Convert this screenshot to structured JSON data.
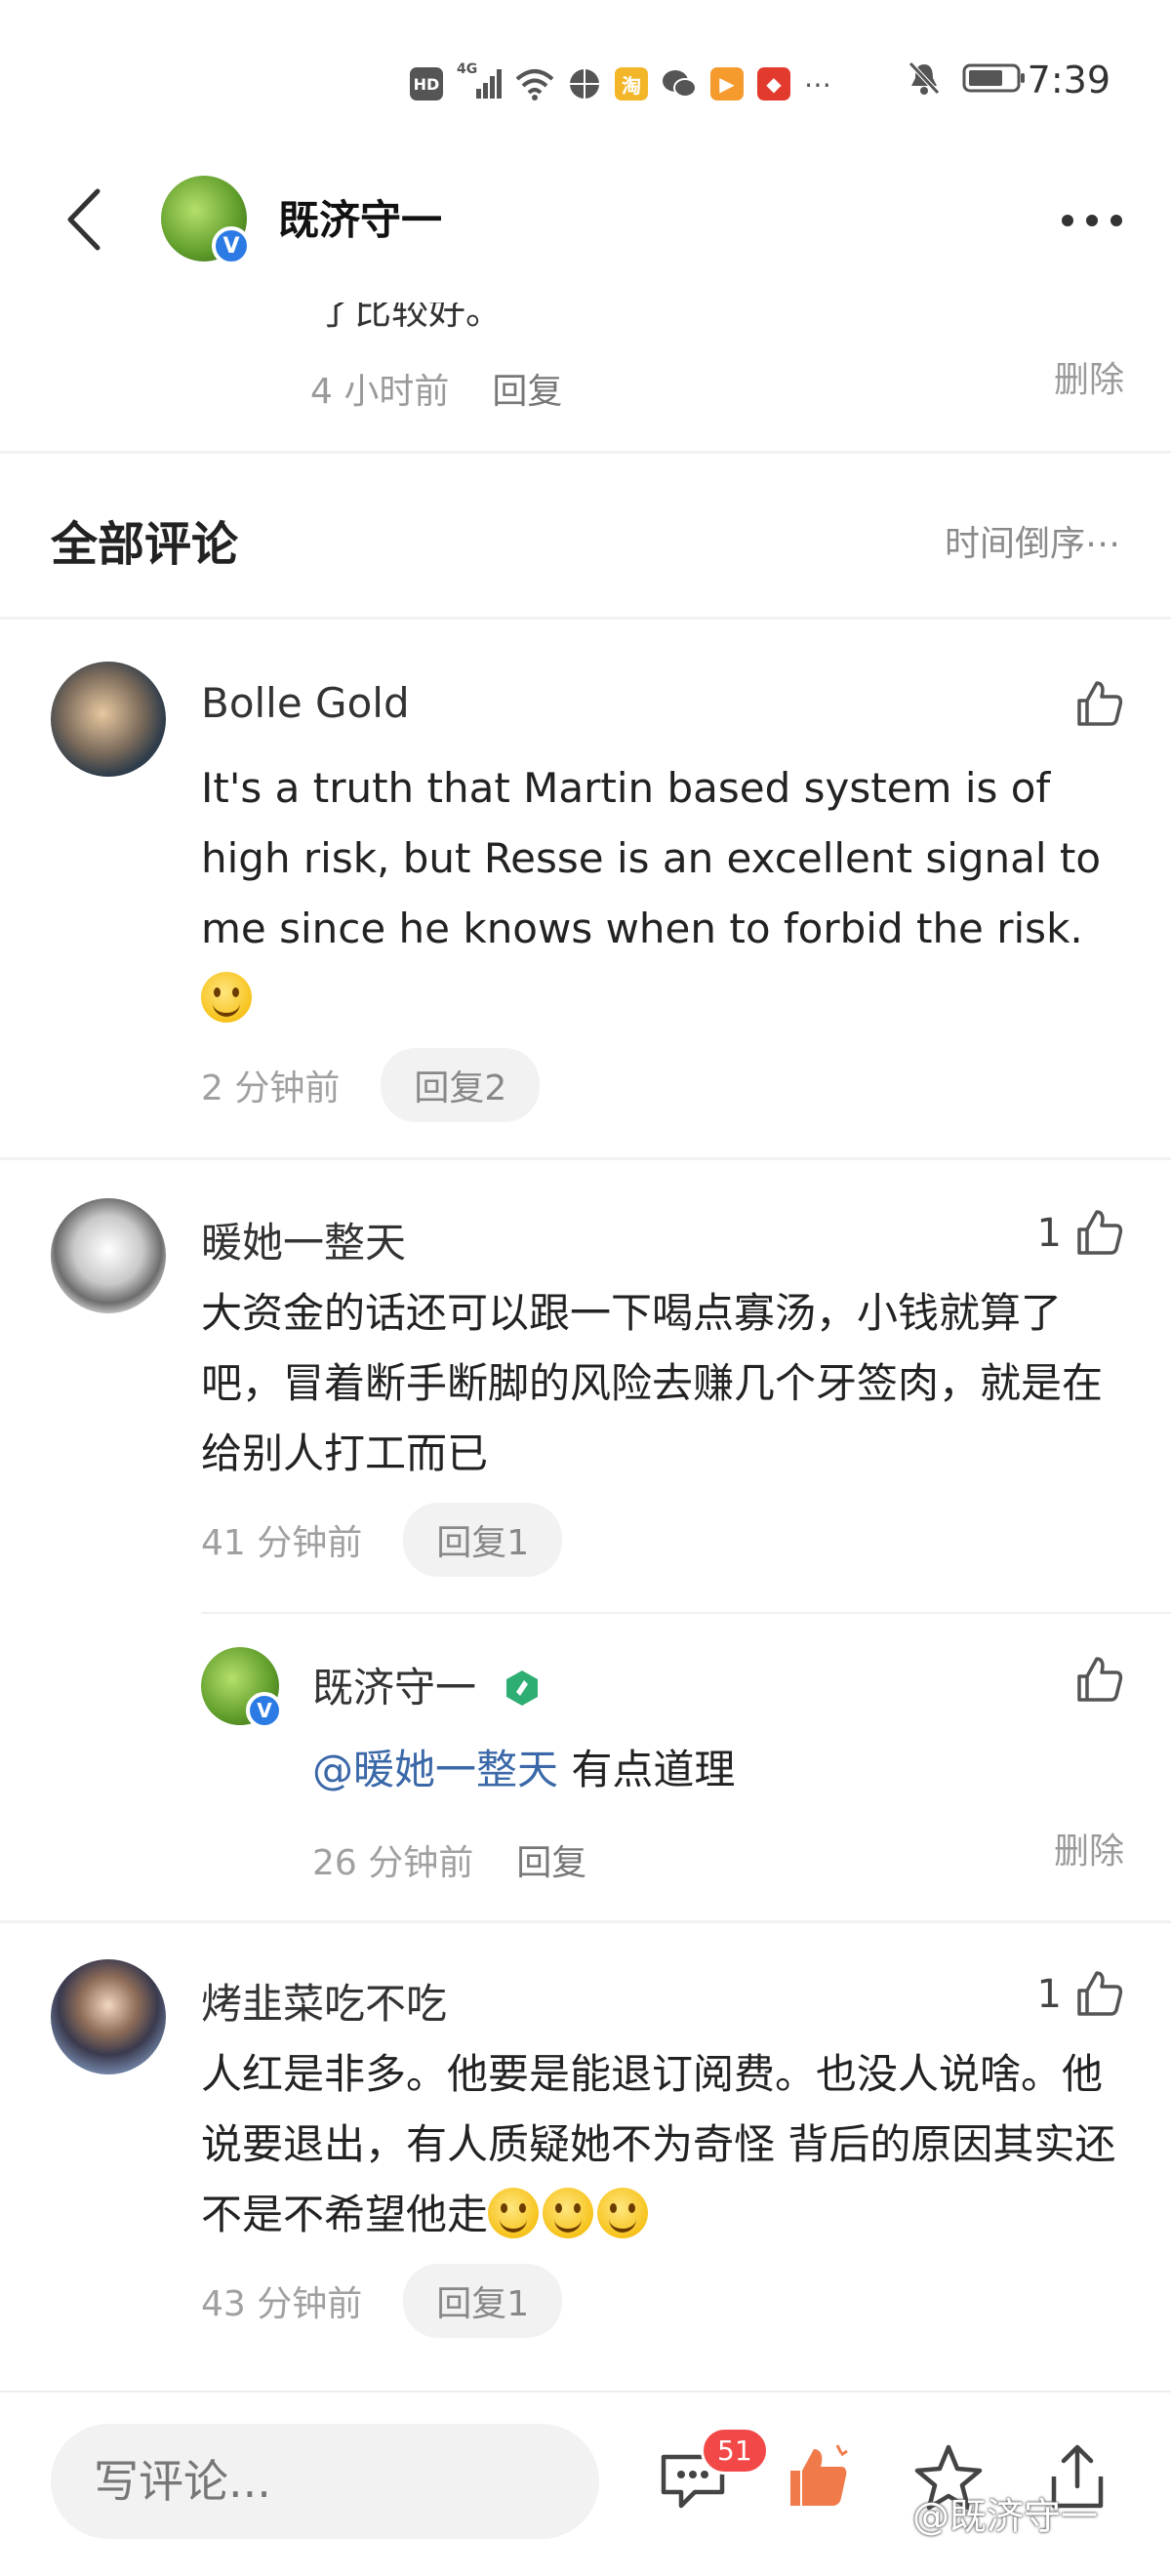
{
  "status_bar": {
    "network": "HD",
    "signal": "4G",
    "time": "7:39"
  },
  "header": {
    "title": "既济守一",
    "verified_mark": "V"
  },
  "top_comment": {
    "partial_text": "了比较好。",
    "time": "4 小时前",
    "reply_label": "回复",
    "delete_label": "删除"
  },
  "section": {
    "title": "全部评论",
    "sort_label": "时间倒序⋯"
  },
  "comments": [
    {
      "name": "Bolle Gold",
      "text": "It's a truth that Martin based system is of high risk, but Resse is an excellent signal to me since he knows when to forbid the risk.",
      "time": "2 分钟前",
      "reply_label": "回复2",
      "likes": ""
    },
    {
      "name": "暖她一整天",
      "text": "大资金的话还可以跟一下喝点寡汤，小钱就算了吧，冒着断手断脚的风险去赚几个牙签肉，就是在给别人打工而已",
      "time": "41 分钟前",
      "reply_label": "回复1",
      "likes": "1",
      "replies": [
        {
          "name": "既济守一",
          "mention": "@暖她一整天",
          "text": " 有点道理",
          "time": "26 分钟前",
          "reply_label": "回复",
          "delete_label": "删除"
        }
      ]
    },
    {
      "name": "烤韭菜吃不吃",
      "text": "人红是非多。他要是能退订阅费。也没人说啥。他说要退出，有人质疑她不为奇怪 背后的原因其实还不是不希望他走",
      "time": "43 分钟前",
      "reply_label": "回复1",
      "likes": "1"
    }
  ],
  "bottom_bar": {
    "input_placeholder": "写评论...",
    "comment_count": "51",
    "watermark": "@既济守一"
  },
  "colors": {
    "accent_blue": "#3b68a8",
    "badge_red": "#f24848",
    "like_orange": "#f07a4a"
  }
}
